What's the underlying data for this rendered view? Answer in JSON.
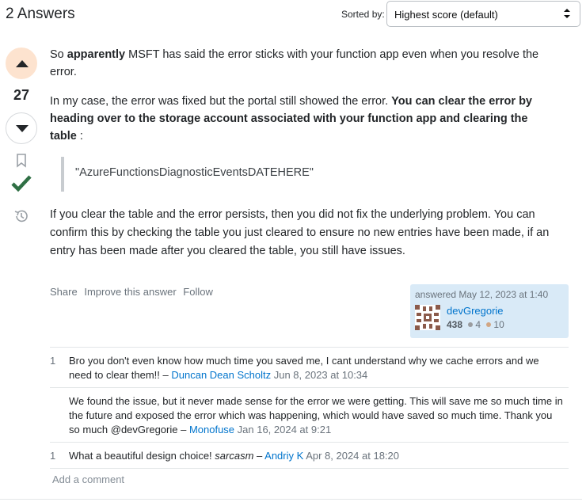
{
  "header": {
    "answers_count": "2 Answers",
    "sorted_label": "Sorted by:",
    "sort_value": "Highest score (default)"
  },
  "vote": {
    "score": "27"
  },
  "post": {
    "p1_a": "So ",
    "p1_bold": "apparently",
    "p1_b": " MSFT has said the error sticks with your function app even when you resolve the error.",
    "p2_a": "In my case, the error was fixed but the portal still showed the error. ",
    "p2_bold": "You can clear the error by heading over to the storage account associated with your function app and clearing the table",
    "p2_b": " :",
    "quote": "\"AzureFunctionsDiagnosticEventsDATEHERE\"",
    "p3": "If you clear the table and the error persists, then you did not fix the underlying problem. You can confirm this by checking the table you just cleared to ensure no new entries have been made, if an entry has been made after you cleared the table, you still have issues."
  },
  "menu": {
    "share": "Share",
    "improve": "Improve this answer",
    "follow": "Follow"
  },
  "user": {
    "action": "answered May 12, 2023 at 1:40",
    "name": "devGregorie",
    "reputation": "438",
    "silver": "4",
    "bronze": "10",
    "silver_color": "#9a9c9f",
    "bronze_color": "#d1a684"
  },
  "comments": [
    {
      "score": "1",
      "text": "Bro you don't even know how much time you saved me, I cant understand why we cache errors and we need to clear them!! – ",
      "author": "Duncan Dean Scholtz",
      "date": " Jun 8, 2023 at 10:34"
    },
    {
      "score": "",
      "text": "We found the issue, but it never made sense for the error we were getting. This will save me so much time in the future and exposed the error which was happening, which would have saved so much time. Thank you so much @devGregorie – ",
      "author": "Monofuse",
      "date": " Jan 16, 2024 at 9:21"
    },
    {
      "score": "1",
      "text_a": "What a beautiful design choice! ",
      "text_em": "sarcasm",
      "text_b": " – ",
      "author": "Andriy K",
      "date": " Apr 8, 2024 at 18:20"
    }
  ],
  "add_comment": "Add a comment",
  "colors": {
    "link": "#0074cc",
    "accept": "#2f6f44",
    "upvote_bg": "#fde3cf",
    "user_card_bg": "#d9eaf7"
  }
}
